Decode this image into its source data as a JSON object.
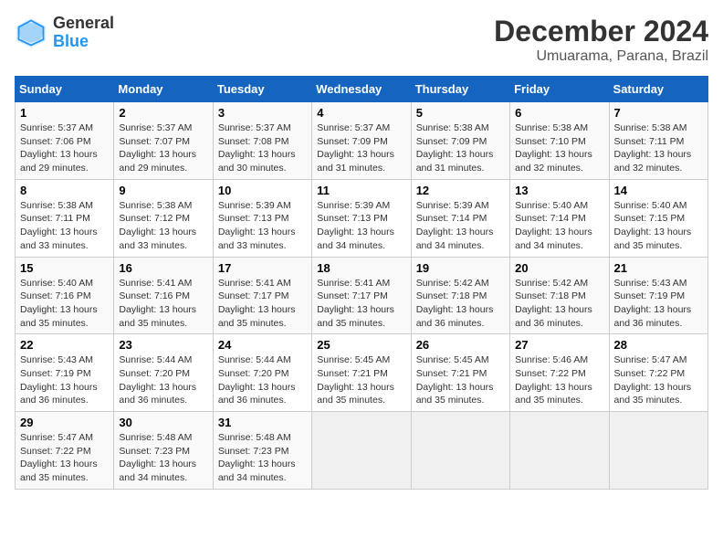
{
  "header": {
    "logo_line1": "General",
    "logo_line2": "Blue",
    "month_year": "December 2024",
    "location": "Umuarama, Parana, Brazil"
  },
  "weekdays": [
    "Sunday",
    "Monday",
    "Tuesday",
    "Wednesday",
    "Thursday",
    "Friday",
    "Saturday"
  ],
  "weeks": [
    [
      {
        "day": "1",
        "info": "Sunrise: 5:37 AM\nSunset: 7:06 PM\nDaylight: 13 hours\nand 29 minutes."
      },
      {
        "day": "2",
        "info": "Sunrise: 5:37 AM\nSunset: 7:07 PM\nDaylight: 13 hours\nand 29 minutes."
      },
      {
        "day": "3",
        "info": "Sunrise: 5:37 AM\nSunset: 7:08 PM\nDaylight: 13 hours\nand 30 minutes."
      },
      {
        "day": "4",
        "info": "Sunrise: 5:37 AM\nSunset: 7:09 PM\nDaylight: 13 hours\nand 31 minutes."
      },
      {
        "day": "5",
        "info": "Sunrise: 5:38 AM\nSunset: 7:09 PM\nDaylight: 13 hours\nand 31 minutes."
      },
      {
        "day": "6",
        "info": "Sunrise: 5:38 AM\nSunset: 7:10 PM\nDaylight: 13 hours\nand 32 minutes."
      },
      {
        "day": "7",
        "info": "Sunrise: 5:38 AM\nSunset: 7:11 PM\nDaylight: 13 hours\nand 32 minutes."
      }
    ],
    [
      {
        "day": "8",
        "info": "Sunrise: 5:38 AM\nSunset: 7:11 PM\nDaylight: 13 hours\nand 33 minutes."
      },
      {
        "day": "9",
        "info": "Sunrise: 5:38 AM\nSunset: 7:12 PM\nDaylight: 13 hours\nand 33 minutes."
      },
      {
        "day": "10",
        "info": "Sunrise: 5:39 AM\nSunset: 7:13 PM\nDaylight: 13 hours\nand 33 minutes."
      },
      {
        "day": "11",
        "info": "Sunrise: 5:39 AM\nSunset: 7:13 PM\nDaylight: 13 hours\nand 34 minutes."
      },
      {
        "day": "12",
        "info": "Sunrise: 5:39 AM\nSunset: 7:14 PM\nDaylight: 13 hours\nand 34 minutes."
      },
      {
        "day": "13",
        "info": "Sunrise: 5:40 AM\nSunset: 7:14 PM\nDaylight: 13 hours\nand 34 minutes."
      },
      {
        "day": "14",
        "info": "Sunrise: 5:40 AM\nSunset: 7:15 PM\nDaylight: 13 hours\nand 35 minutes."
      }
    ],
    [
      {
        "day": "15",
        "info": "Sunrise: 5:40 AM\nSunset: 7:16 PM\nDaylight: 13 hours\nand 35 minutes."
      },
      {
        "day": "16",
        "info": "Sunrise: 5:41 AM\nSunset: 7:16 PM\nDaylight: 13 hours\nand 35 minutes."
      },
      {
        "day": "17",
        "info": "Sunrise: 5:41 AM\nSunset: 7:17 PM\nDaylight: 13 hours\nand 35 minutes."
      },
      {
        "day": "18",
        "info": "Sunrise: 5:41 AM\nSunset: 7:17 PM\nDaylight: 13 hours\nand 35 minutes."
      },
      {
        "day": "19",
        "info": "Sunrise: 5:42 AM\nSunset: 7:18 PM\nDaylight: 13 hours\nand 36 minutes."
      },
      {
        "day": "20",
        "info": "Sunrise: 5:42 AM\nSunset: 7:18 PM\nDaylight: 13 hours\nand 36 minutes."
      },
      {
        "day": "21",
        "info": "Sunrise: 5:43 AM\nSunset: 7:19 PM\nDaylight: 13 hours\nand 36 minutes."
      }
    ],
    [
      {
        "day": "22",
        "info": "Sunrise: 5:43 AM\nSunset: 7:19 PM\nDaylight: 13 hours\nand 36 minutes."
      },
      {
        "day": "23",
        "info": "Sunrise: 5:44 AM\nSunset: 7:20 PM\nDaylight: 13 hours\nand 36 minutes."
      },
      {
        "day": "24",
        "info": "Sunrise: 5:44 AM\nSunset: 7:20 PM\nDaylight: 13 hours\nand 36 minutes."
      },
      {
        "day": "25",
        "info": "Sunrise: 5:45 AM\nSunset: 7:21 PM\nDaylight: 13 hours\nand 35 minutes."
      },
      {
        "day": "26",
        "info": "Sunrise: 5:45 AM\nSunset: 7:21 PM\nDaylight: 13 hours\nand 35 minutes."
      },
      {
        "day": "27",
        "info": "Sunrise: 5:46 AM\nSunset: 7:22 PM\nDaylight: 13 hours\nand 35 minutes."
      },
      {
        "day": "28",
        "info": "Sunrise: 5:47 AM\nSunset: 7:22 PM\nDaylight: 13 hours\nand 35 minutes."
      }
    ],
    [
      {
        "day": "29",
        "info": "Sunrise: 5:47 AM\nSunset: 7:22 PM\nDaylight: 13 hours\nand 35 minutes."
      },
      {
        "day": "30",
        "info": "Sunrise: 5:48 AM\nSunset: 7:23 PM\nDaylight: 13 hours\nand 34 minutes."
      },
      {
        "day": "31",
        "info": "Sunrise: 5:48 AM\nSunset: 7:23 PM\nDaylight: 13 hours\nand 34 minutes."
      },
      {
        "day": "",
        "info": ""
      },
      {
        "day": "",
        "info": ""
      },
      {
        "day": "",
        "info": ""
      },
      {
        "day": "",
        "info": ""
      }
    ]
  ]
}
